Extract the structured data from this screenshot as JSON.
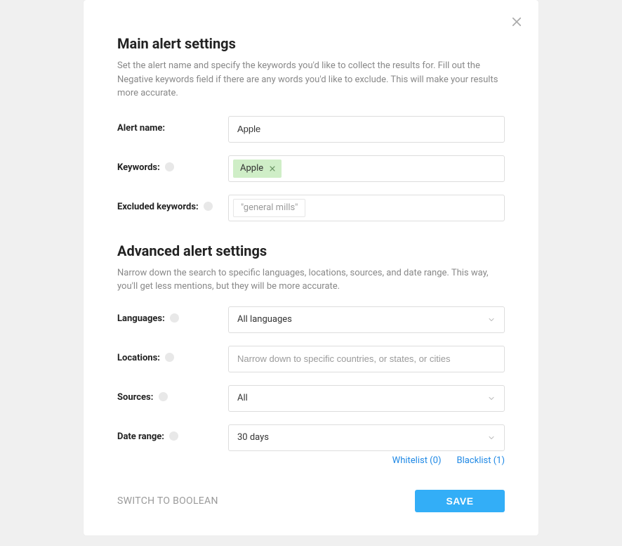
{
  "main": {
    "title": "Main alert settings",
    "desc": "Set the alert name and specify the keywords you'd like to collect the results for. Fill out the Negative keywords field if there are any words you'd like to exclude. This will make your results more accurate."
  },
  "fields": {
    "alert_name_label": "Alert name:",
    "alert_name_value": "Apple",
    "keywords_label": "Keywords:",
    "keywords_tag": "Apple",
    "excluded_label": "Excluded keywords:",
    "excluded_placeholder": "\"general mills\""
  },
  "advanced": {
    "title": "Advanced alert settings",
    "desc": "Narrow down the search to specific languages, locations, sources, and date range. This way, you'll get less mentions, but they will be more accurate.",
    "languages_label": "Languages:",
    "languages_value": "All languages",
    "locations_label": "Locations:",
    "locations_placeholder": "Narrow down to specific countries, or states, or cities",
    "sources_label": "Sources:",
    "sources_value": "All",
    "date_label": "Date range:",
    "date_value": "30 days"
  },
  "links": {
    "whitelist": "Whitelist (0)",
    "blacklist": "Blacklist (1)"
  },
  "footer": {
    "switch": "SWITCH TO BOOLEAN",
    "save": "SAVE"
  }
}
